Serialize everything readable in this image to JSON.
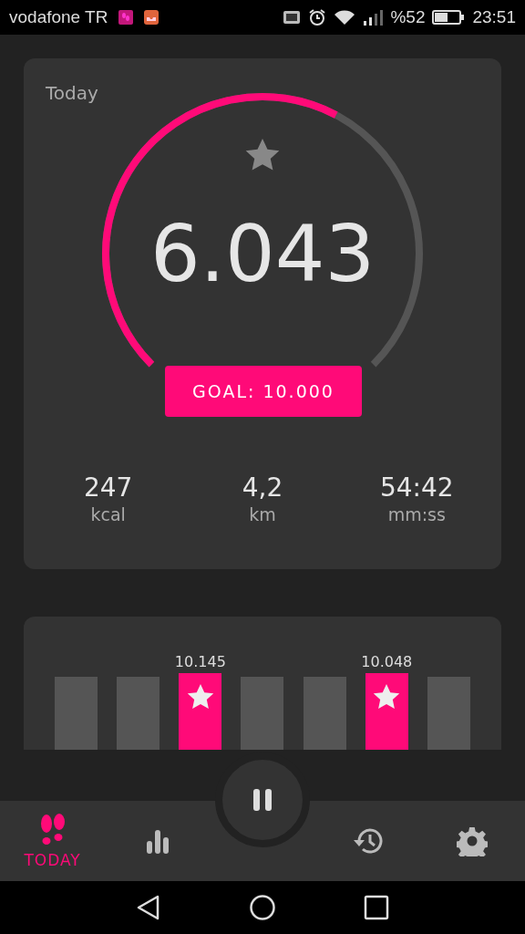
{
  "status_bar": {
    "carrier": "vodafone TR",
    "battery": "%52",
    "time": "23:51"
  },
  "today_card": {
    "title": "Today",
    "steps": "6.043",
    "goal": "GOAL: 10.000",
    "stats": [
      {
        "value": "247",
        "unit": "kcal"
      },
      {
        "value": "4,2",
        "unit": "km"
      },
      {
        "value": "54:42",
        "unit": "mm:ss"
      }
    ]
  },
  "week_bars": [
    {
      "goal_reached": false
    },
    {
      "goal_reached": false
    },
    {
      "goal_reached": true,
      "label": "10.145"
    },
    {
      "goal_reached": false
    },
    {
      "goal_reached": false
    },
    {
      "goal_reached": true,
      "label": "10.048"
    },
    {
      "goal_reached": false
    }
  ],
  "tabs": [
    {
      "kind": "today",
      "label": "TODAY",
      "selected": true
    },
    {
      "kind": "stats",
      "selected": false
    },
    {
      "kind": "pause",
      "selected": false
    },
    {
      "kind": "history",
      "selected": false
    },
    {
      "kind": "settings",
      "selected": false
    }
  ]
}
